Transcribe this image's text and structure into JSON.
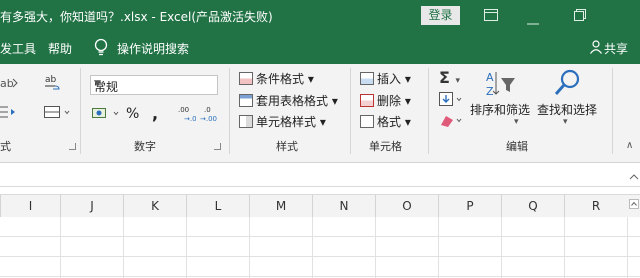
{
  "titlebar": {
    "title": "有多强大，你知道吗？.xlsx  -  Excel(产品激活失败)",
    "login_label": "登录",
    "icons": [
      "ribbon-display-options-icon",
      "minimize-icon",
      "restore-icon"
    ]
  },
  "menubar": {
    "items": [
      "发工具",
      "帮助",
      "操作说明搜索"
    ],
    "share_label": "共享"
  },
  "ribbon": {
    "groups": {
      "alignment": {
        "label": "式"
      },
      "number": {
        "label": "数字",
        "format_value": "常规",
        "percent_symbol": "%",
        "comma_symbol": ",",
        "increase_decimal": ".00 →.0",
        "decrease_decimal": "→.00"
      },
      "styles": {
        "label": "样式",
        "conditional_format": "条件格式",
        "table_format": "套用表格格式",
        "cell_styles": "单元格样式"
      },
      "cells": {
        "label": "单元格",
        "insert": "插入",
        "delete": "删除",
        "format": "格式"
      },
      "editing": {
        "label": "编辑",
        "sort_filter": "排序和筛选",
        "find_select": "查找和选择"
      }
    }
  },
  "columns": [
    "I",
    "J",
    "K",
    "L",
    "M",
    "N",
    "O",
    "P",
    "Q",
    "R"
  ],
  "colors": {
    "accent": "#217346",
    "ribbon_bg": "#f3f3f3"
  }
}
